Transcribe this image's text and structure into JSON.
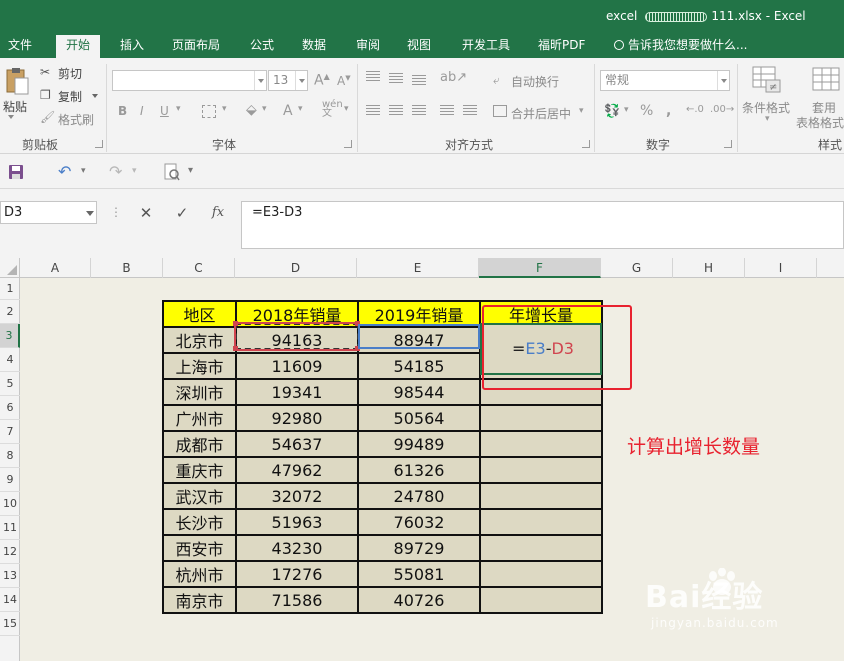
{
  "window": {
    "app_title": "excel",
    "file_title": "111.xlsx - Excel"
  },
  "menu_tabs": [
    "文件",
    "开始",
    "插入",
    "页面布局",
    "公式",
    "数据",
    "审阅",
    "视图",
    "开发工具",
    "福昕PDF"
  ],
  "active_tab": "开始",
  "tell_me": "告诉我您想要做什么...",
  "ribbon": {
    "clipboard": {
      "paste": "粘贴",
      "cut": "剪切",
      "copy": "复制",
      "format_painter": "格式刷",
      "group": "剪贴板"
    },
    "font": {
      "size": "13",
      "group": "字体"
    },
    "alignment": {
      "wrap": "自动换行",
      "merge": "合并后居中",
      "group": "对齐方式"
    },
    "number": {
      "format": "常规",
      "group": "数字"
    },
    "styles": {
      "conditional": "条件格式",
      "table_1": "套用",
      "table_2": "表格格式",
      "group": "样式"
    }
  },
  "formula_bar": {
    "name_box": "D3",
    "formula": "=E3-D3"
  },
  "columns": [
    "A",
    "B",
    "C",
    "D",
    "E",
    "F",
    "G",
    "H",
    "I"
  ],
  "rows": [
    "1",
    "2",
    "3",
    "4",
    "5",
    "6",
    "7",
    "8",
    "9",
    "10",
    "11",
    "12",
    "13",
    "14",
    "15"
  ],
  "table": {
    "headers": [
      "地区",
      "2018年销量",
      "2019年销量",
      "年增长量"
    ],
    "rows": [
      [
        "北京市",
        "94163",
        "88947",
        ""
      ],
      [
        "上海市",
        "11609",
        "54185",
        ""
      ],
      [
        "深圳市",
        "19341",
        "98544",
        ""
      ],
      [
        "广州市",
        "92980",
        "50564",
        ""
      ],
      [
        "成都市",
        "54637",
        "99489",
        ""
      ],
      [
        "重庆市",
        "47962",
        "61326",
        ""
      ],
      [
        "武汉市",
        "32072",
        "24780",
        ""
      ],
      [
        "长沙市",
        "51963",
        "76032",
        ""
      ],
      [
        "西安市",
        "43230",
        "89729",
        ""
      ],
      [
        "杭州市",
        "17276",
        "55081",
        ""
      ],
      [
        "南京市",
        "71586",
        "40726",
        ""
      ]
    ]
  },
  "active_cell_formula": {
    "eq": "=",
    "ref_e": "E3",
    "minus": "-",
    "ref_d": "D3"
  },
  "annotation": "计算出增长数量",
  "watermark": {
    "main": "Bai经验",
    "sub": "jingyan.baidu.com"
  },
  "colors": {
    "excel_green": "#227447",
    "header_yellow": "#ffff00",
    "cell_fill": "#ddd9c3",
    "annotation_red": "#e8222f",
    "ref_blue": "#4a7ec8"
  }
}
